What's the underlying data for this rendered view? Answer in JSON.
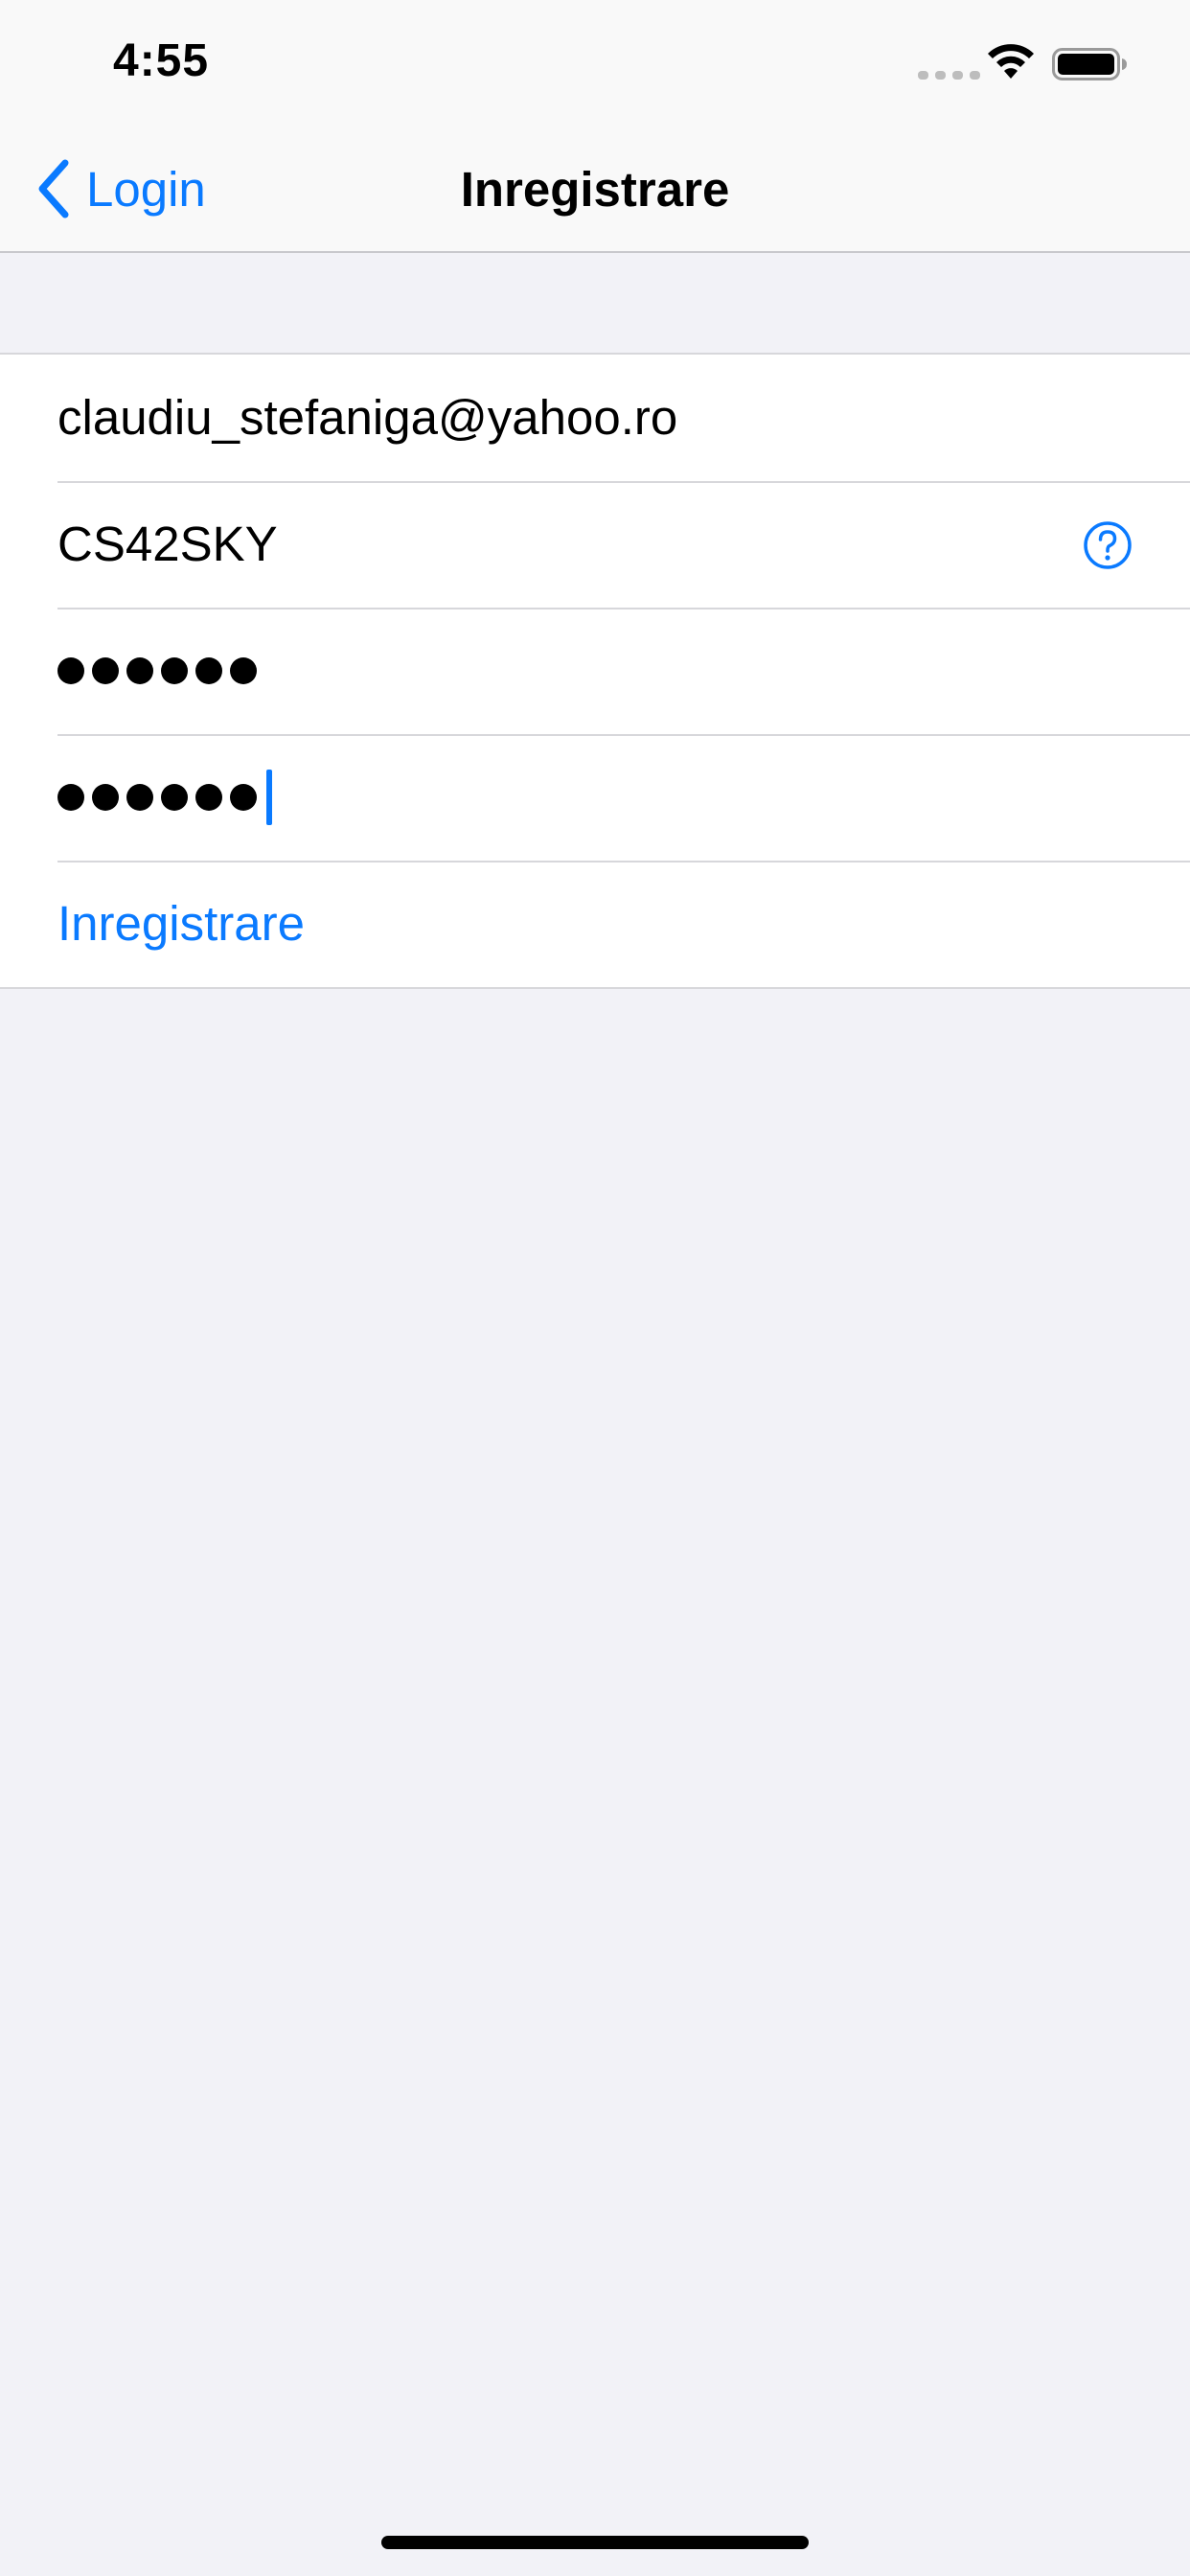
{
  "status_bar": {
    "time": "4:55"
  },
  "nav": {
    "back_label": "Login",
    "title": "Inregistrare"
  },
  "form": {
    "email_value": "claudiu_stefaniga@yahoo.ro",
    "username_value": "CS42SKY",
    "password_mask_count": 6,
    "confirm_password_mask_count": 6,
    "submit_label": "Inregistrare"
  },
  "icons": {
    "back": "chevron-left-icon",
    "help": "question-circle-icon",
    "wifi": "wifi-icon",
    "battery": "battery-icon",
    "cellular": "cellular-signal-icon"
  },
  "colors": {
    "accent": "#0a7aff",
    "background": "#f2f2f7",
    "cell": "#ffffff",
    "separator": "#d7d7db"
  }
}
